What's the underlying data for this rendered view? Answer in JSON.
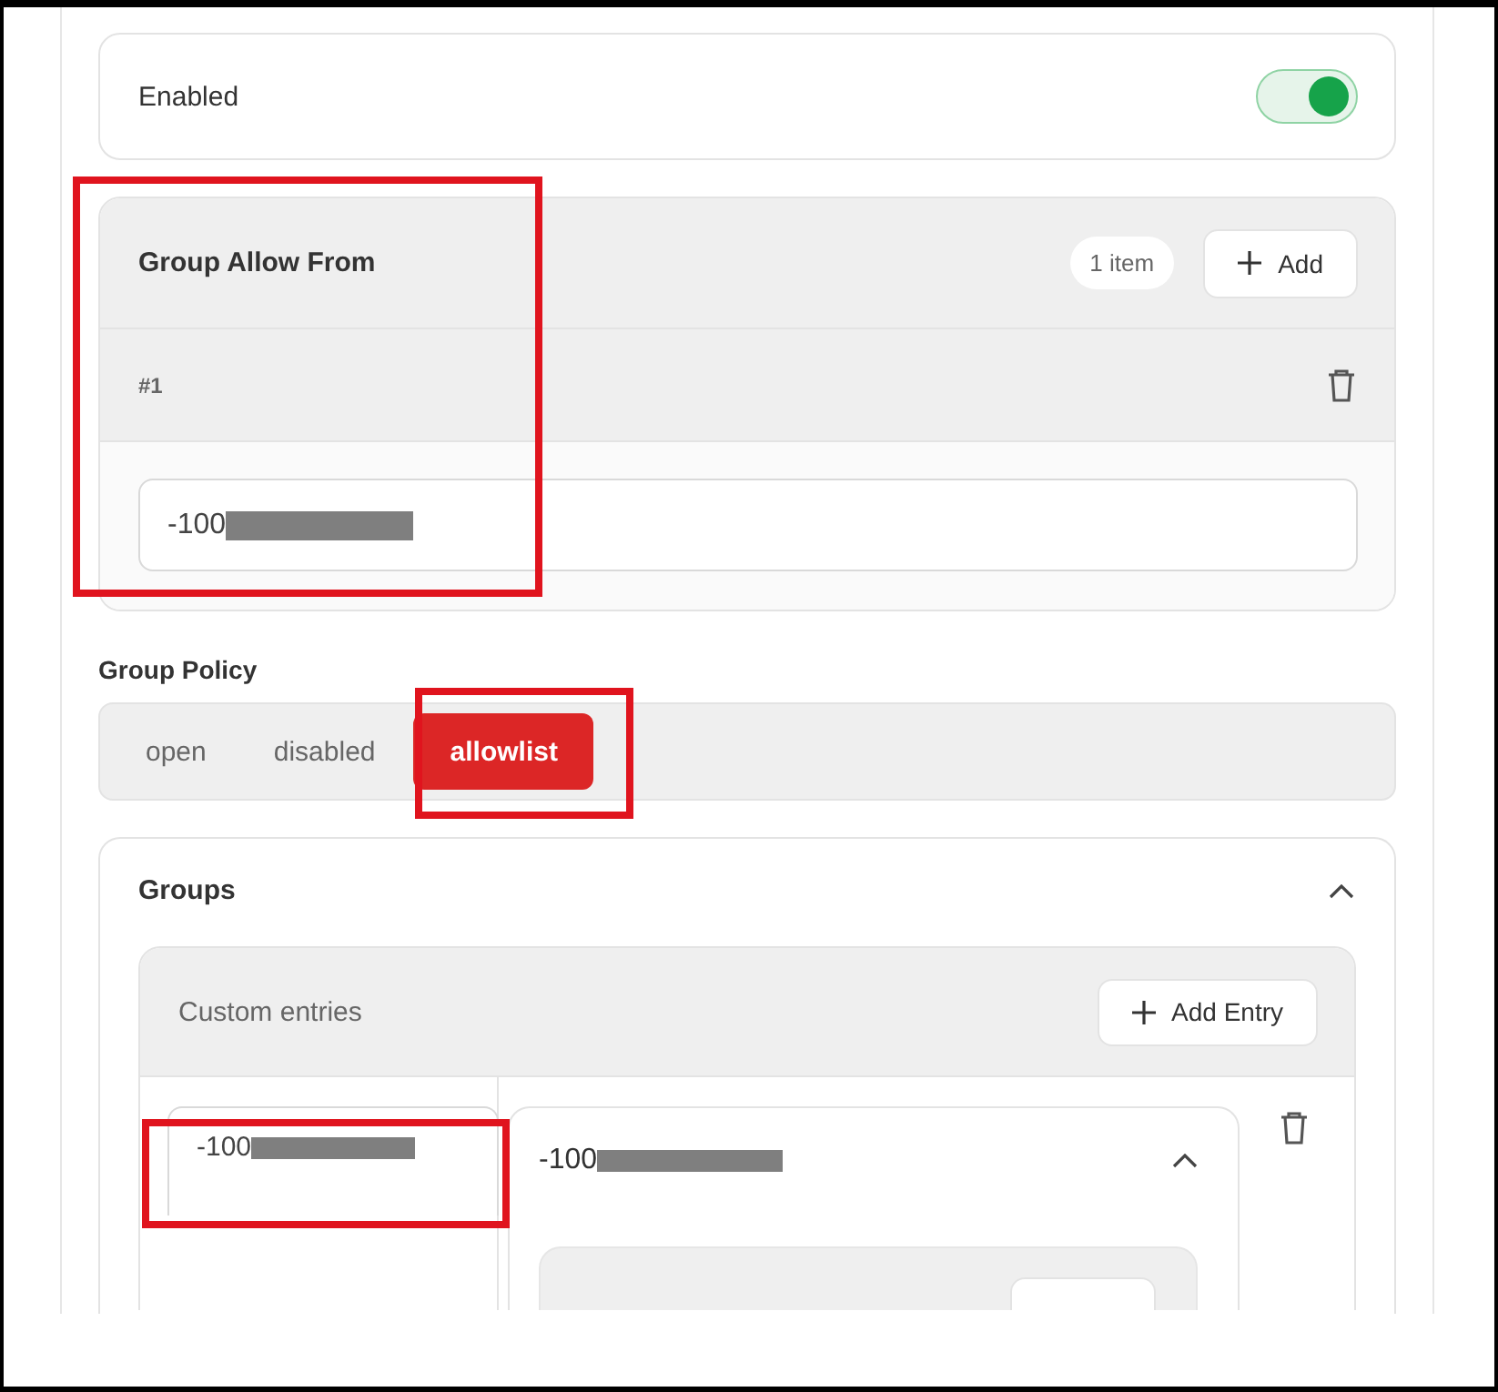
{
  "enabled": {
    "label": "Enabled",
    "on": true
  },
  "group_allow_from": {
    "title": "Group Allow From",
    "count": "1 item",
    "add_button": "Add",
    "items": [
      {
        "index": "#1",
        "value": "-100",
        "redacted": true
      }
    ]
  },
  "group_policy": {
    "label": "Group Policy",
    "options": [
      {
        "label": "open",
        "selected": false
      },
      {
        "label": "disabled",
        "selected": false
      },
      {
        "label": "allowlist",
        "selected": true
      }
    ]
  },
  "groups": {
    "title": "Groups",
    "expanded": true,
    "custom_entries": {
      "title": "Custom entries",
      "add_button": "Add Entry",
      "entries": [
        {
          "key": "-100",
          "key_redacted": true,
          "title": "-100",
          "title_redacted": true,
          "expanded": true
        }
      ]
    }
  }
}
